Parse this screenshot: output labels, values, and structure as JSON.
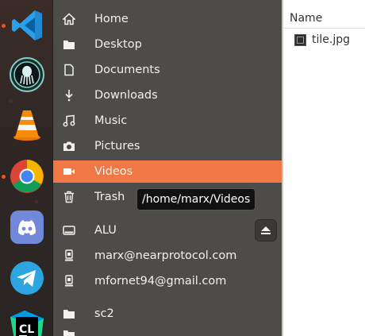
{
  "dock": {
    "apps": [
      {
        "name": "Visual Studio Code",
        "icon": "vscode-icon",
        "running": true
      },
      {
        "name": "GitKraken",
        "icon": "gitkraken-icon",
        "running": false
      },
      {
        "name": "VLC",
        "icon": "vlc-icon",
        "running": false
      },
      {
        "name": "Chrome",
        "icon": "chrome-icon",
        "running": true
      },
      {
        "name": "Discord",
        "icon": "discord-icon",
        "running": false
      },
      {
        "name": "Telegram",
        "icon": "telegram-icon",
        "running": false
      },
      {
        "name": "CLion",
        "icon": "clion-icon",
        "running": false,
        "label": "CL"
      }
    ]
  },
  "sidebar": {
    "items": [
      {
        "label": "Home",
        "icon": "home-icon"
      },
      {
        "label": "Desktop",
        "icon": "folder-icon"
      },
      {
        "label": "Documents",
        "icon": "document-icon"
      },
      {
        "label": "Downloads",
        "icon": "download-icon"
      },
      {
        "label": "Music",
        "icon": "music-icon"
      },
      {
        "label": "Pictures",
        "icon": "camera-icon"
      },
      {
        "label": "Videos",
        "icon": "video-icon",
        "active": true
      },
      {
        "label": "Trash",
        "icon": "trash-icon"
      },
      {
        "label": "ALU",
        "icon": "drive-icon"
      },
      {
        "label": "marx@nearprotocol.com",
        "icon": "account-icon"
      },
      {
        "label": "mfornet94@gmail.com",
        "icon": "account-icon"
      },
      {
        "label": "sc2",
        "icon": "folder-icon"
      }
    ],
    "tooltip": "/home/marx/Videos"
  },
  "fileview": {
    "column_header": "Name",
    "files": [
      {
        "name": "tile.jpg",
        "icon": "image-file-icon"
      }
    ]
  },
  "colors": {
    "accent": "#f07746",
    "sidebar_bg": "#4d4c48",
    "running_dot": "#e95420"
  }
}
